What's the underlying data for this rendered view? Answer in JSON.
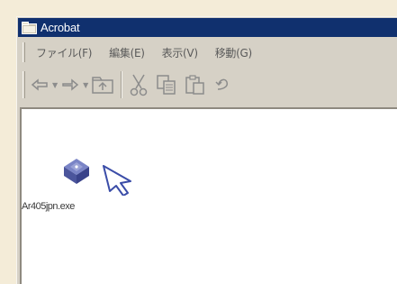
{
  "window": {
    "title": "Acrobat"
  },
  "menu": {
    "file": "ファイル(F)",
    "edit": "編集(E)",
    "view": "表示(V)",
    "go": "移動(G)"
  },
  "toolbar": {
    "icons": [
      "back-icon",
      "forward-icon",
      "up-folder-icon",
      "cut-icon",
      "copy-icon",
      "paste-icon",
      "undo-icon"
    ]
  },
  "files": [
    {
      "name": "Ar405jpn.exe",
      "icon": "installer-exe-icon"
    }
  ],
  "colors": {
    "titlebar": "#10306e",
    "chrome": "#d6d1c6",
    "background": "#f4ecd8"
  }
}
